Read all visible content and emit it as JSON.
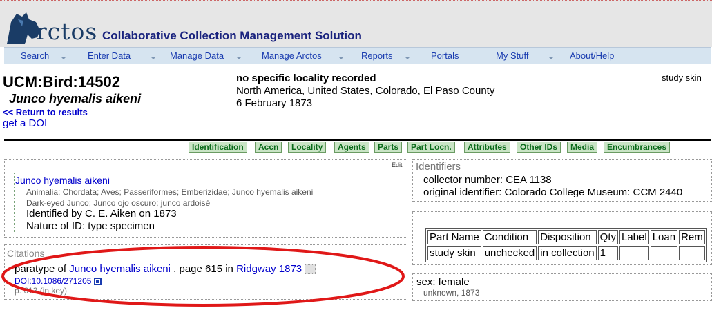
{
  "header": {
    "logo_text": "rctos",
    "tagline": "Collaborative Collection Management Solution",
    "accent_color": "#1a3c66"
  },
  "nav": {
    "items": [
      {
        "label": "Search",
        "dropdown": true
      },
      {
        "label": "Enter Data",
        "dropdown": true
      },
      {
        "label": "Manage Data",
        "dropdown": true
      },
      {
        "label": "Manage Arctos",
        "dropdown": true
      },
      {
        "label": "Reports",
        "dropdown": true
      },
      {
        "label": "Portals",
        "dropdown": false
      },
      {
        "label": "My Stuff",
        "dropdown": true
      },
      {
        "label": "About/Help",
        "dropdown": false
      }
    ]
  },
  "record": {
    "guid": "UCM:Bird:14502",
    "scientific_name": "Junco hyemalis aikeni",
    "return_link": "<< Return to results",
    "doi_link": "get a DOI",
    "specific_locality": "no specific locality recorded",
    "higher_geography": "North America, United States, Colorado, El Paso County",
    "date": "6 February 1873",
    "parts_summary": "study skin"
  },
  "tabs": [
    "Identification",
    "Accn",
    "Locality",
    "Agents",
    "Parts",
    "Part Locn.",
    "Attributes",
    "Other IDs",
    "Media",
    "Encumbrances"
  ],
  "identification": {
    "edit_label": "Edit",
    "taxon": "Junco hyemalis aikeni",
    "classification": "Animalia; Chordata; Aves; Passeriformes; Emberizidae; Junco hyemalis aikeni",
    "common_names": "Dark-eyed Junco; Junco ojo oscuro; junco ardoisé",
    "identified_by": "Identified by C. E. Aiken on 1873",
    "nature_of_id": "Nature of ID: type specimen"
  },
  "citations": {
    "heading": "Citations",
    "type_status": "paratype of",
    "taxon": "Junco hyemalis aikeni",
    "page": ", page 615 in",
    "publication": "Ridgway 1873",
    "doi": "DOI:10.1086/271205",
    "page_note": "p. 613 (in key)"
  },
  "identifiers": {
    "heading": "Identifiers",
    "collector_number": "collector number: CEA 1138",
    "original_identifier": "original identifier: Colorado College Museum: CCM 2440"
  },
  "parts_table": {
    "headers": [
      "Part Name",
      "Condition",
      "Disposition",
      "Qty",
      "Label",
      "Loan",
      "Rem"
    ],
    "rows": [
      [
        "study skin",
        "unchecked",
        "in collection",
        "1",
        "",
        "",
        ""
      ]
    ]
  },
  "attributes": {
    "sex": "sex: female",
    "determiner": "unknown, 1873"
  }
}
